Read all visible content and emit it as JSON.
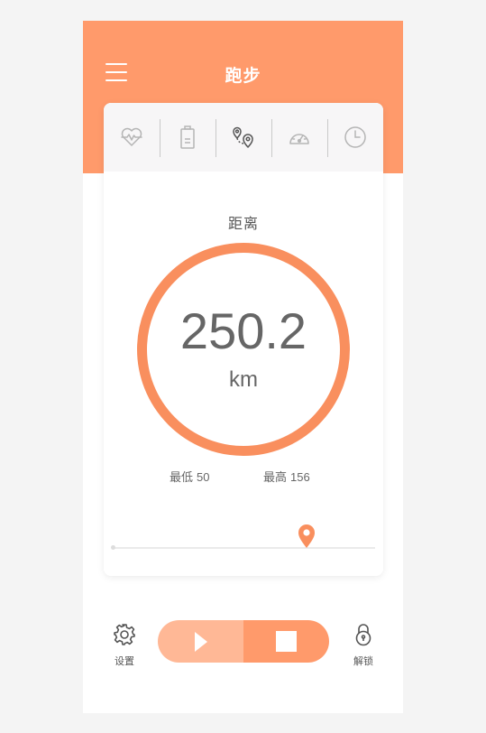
{
  "header": {
    "title": "跑步"
  },
  "tabs": [
    {
      "icon": "heart-rate-icon"
    },
    {
      "icon": "battery-icon"
    },
    {
      "icon": "location-route-icon",
      "active": true
    },
    {
      "icon": "speedometer-icon"
    },
    {
      "icon": "clock-icon"
    }
  ],
  "metric": {
    "label": "距离",
    "value": "250.2",
    "unit": "km"
  },
  "stats": {
    "min_label": "最低",
    "min_value": "50",
    "max_label": "最高",
    "max_value": "156"
  },
  "progress": {
    "position_fraction": 0.74
  },
  "bottom": {
    "settings_label": "设置",
    "unlock_label": "解锁",
    "play_icon": "play-icon",
    "stop_icon": "stop-icon"
  },
  "colors": {
    "accent": "#ff9a6b",
    "ring": "#f98f5e",
    "play_bg": "#ffb896",
    "text": "#666666"
  }
}
